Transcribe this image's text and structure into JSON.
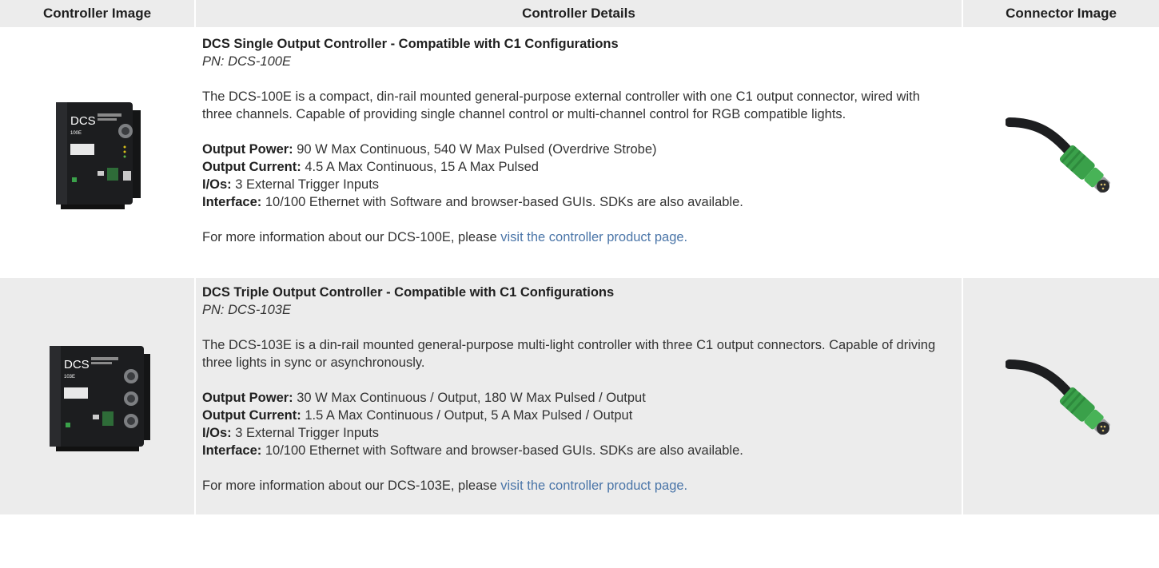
{
  "header": {
    "controller_image": "Controller Image",
    "controller_details": "Controller Details",
    "connector_image": "Connector Image"
  },
  "rows": [
    {
      "title": "DCS Single Output Controller - Compatible with C1 Configurations",
      "pn": "PN: DCS-100E",
      "description": "The DCS-100E is a compact, din-rail mounted general-purpose external controller with one C1 output connector, wired with three channels. Capable of providing single channel control or multi-channel control for RGB compatible lights.",
      "specs": [
        {
          "label": "Output Power:",
          "value": " 90 W Max Continuous, 540 W Max Pulsed (Overdrive Strobe)"
        },
        {
          "label": "Output Current:",
          "value": " 4.5 A Max Continuous, 15 A Max Pulsed"
        },
        {
          "label": "I/Os:",
          "value": " 3 External Trigger Inputs"
        },
        {
          "label": "Interface:",
          "value": " 10/100 Ethernet with Software and browser-based GUIs. SDKs are also available."
        }
      ],
      "more_prefix": "For more information about our DCS-100E, please ",
      "more_link": "visit the controller product page.",
      "device_brand": "DCS",
      "device_model": "100E"
    },
    {
      "title": "DCS Triple Output Controller - Compatible with C1 Configurations",
      "pn": "PN: DCS-103E",
      "description": "The DCS-103E is a din-rail mounted general-purpose multi-light controller with three C1 output connectors. Capable of driving three lights in sync or asynchronously.",
      "specs": [
        {
          "label": "Output Power:",
          "value": " 30 W Max Continuous / Output, 180 W Max Pulsed / Output"
        },
        {
          "label": "Output Current:",
          "value": " 1.5 A Max Continuous / Output, 5 A Max Pulsed / Output"
        },
        {
          "label": "I/Os:",
          "value": " 3 External Trigger Inputs"
        },
        {
          "label": "Interface:",
          "value": " 10/100 Ethernet with Software and browser-based GUIs. SDKs are also available."
        }
      ],
      "more_prefix": "For more information about our DCS-103E, please ",
      "more_link": "visit the controller product page.",
      "device_brand": "DCS",
      "device_model": "103E"
    }
  ],
  "colors": {
    "header_bg": "#ececec",
    "link": "#4a75a8",
    "connector_green": "#3aa14a",
    "device_body": "#1c1d1f"
  },
  "icons": [
    "controller-device-image",
    "connector-cable-image"
  ]
}
